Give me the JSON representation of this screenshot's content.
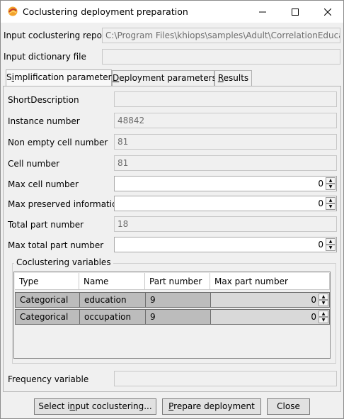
{
  "window": {
    "title": "Coclustering deployment preparation",
    "app_icon": "khiops-icon"
  },
  "header": {
    "input_coclustering_report_label": "Input coclustering report",
    "input_coclustering_report_value": "C:\\Program Files\\khiops\\samples\\Adult\\CorrelationEducation",
    "input_dictionary_file_label": "Input dictionary file",
    "input_dictionary_file_value": ""
  },
  "tabs": [
    {
      "label": "Simplification parameters",
      "selected": true
    },
    {
      "label": "Deployment parameters",
      "selected": false
    },
    {
      "label": "Results",
      "selected": false
    }
  ],
  "simplification": {
    "short_description_label": "ShortDescription",
    "short_description_value": "",
    "instance_number_label": "Instance number",
    "instance_number_value": "48842",
    "non_empty_cell_number_label": "Non empty cell number",
    "non_empty_cell_number_value": "81",
    "cell_number_label": "Cell number",
    "cell_number_value": "81",
    "max_cell_number_label": "Max cell number",
    "max_cell_number_value": "0",
    "max_preserved_information_label": "Max preserved information",
    "max_preserved_information_value": "0",
    "total_part_number_label": "Total part number",
    "total_part_number_value": "18",
    "max_total_part_number_label": "Max total part number",
    "max_total_part_number_value": "0"
  },
  "coclustering_variables": {
    "group_title": "Coclustering variables",
    "columns": [
      "Type",
      "Name",
      "Part number",
      "Max part number"
    ],
    "rows": [
      {
        "type": "Categorical",
        "name": "education",
        "part_number": "9",
        "max_part_number": "0"
      },
      {
        "type": "Categorical",
        "name": "occupation",
        "part_number": "9",
        "max_part_number": "0"
      }
    ]
  },
  "frequency_variable": {
    "label": "Frequency variable",
    "value": ""
  },
  "buttons": {
    "select_input": "Select input coclustering...",
    "prepare": "Prepare deployment",
    "close": "Close"
  }
}
